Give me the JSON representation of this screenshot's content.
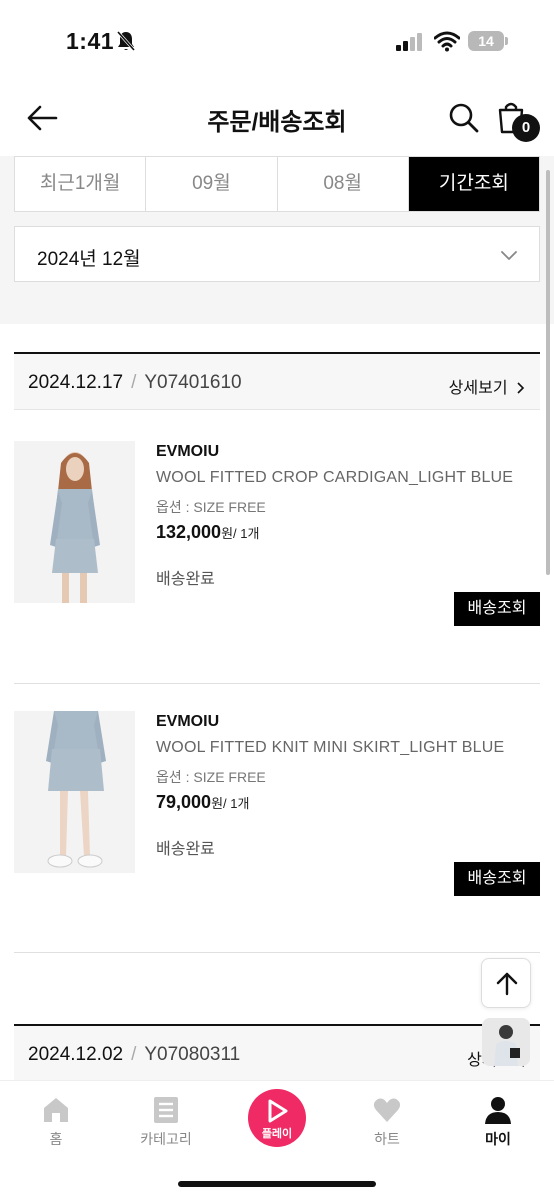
{
  "status_bar": {
    "time": "1:41",
    "battery": "14"
  },
  "header": {
    "title": "주문/배송조회",
    "cart_count": "0"
  },
  "filter": {
    "tabs": [
      "최근1개월",
      "09월",
      "08월",
      "기간조회"
    ],
    "selected_tab": "기간조회",
    "period": "2024년 12월"
  },
  "orders": [
    {
      "date": "2024.12.17",
      "separator": "/",
      "order_number": "Y07401610",
      "detail_label": "상세보기",
      "items": [
        {
          "brand": "EVMOIU",
          "name": "WOOL FITTED CROP CARDIGAN_LIGHT BLUE",
          "option": "옵션 : SIZE FREE",
          "price": "132,000",
          "price_suffix": "원/ 1개",
          "status": "배송완료",
          "track_label": "배송조회"
        },
        {
          "brand": "EVMOIU",
          "name": "WOOL FITTED KNIT MINI SKIRT_LIGHT BLUE",
          "option": "옵션 : SIZE FREE",
          "price": "79,000",
          "price_suffix": "원/ 1개",
          "status": "배송완료",
          "track_label": "배송조회"
        }
      ]
    },
    {
      "date": "2024.12.02",
      "separator": "/",
      "order_number": "Y07080311",
      "detail_label": "상세보기"
    }
  ],
  "bottom_nav": {
    "home": "홈",
    "category": "카테고리",
    "play": "플레이",
    "heart": "하트",
    "my": "마이"
  },
  "colors": {
    "accent_play": "#ef2a64",
    "active_tab": "#000000"
  }
}
